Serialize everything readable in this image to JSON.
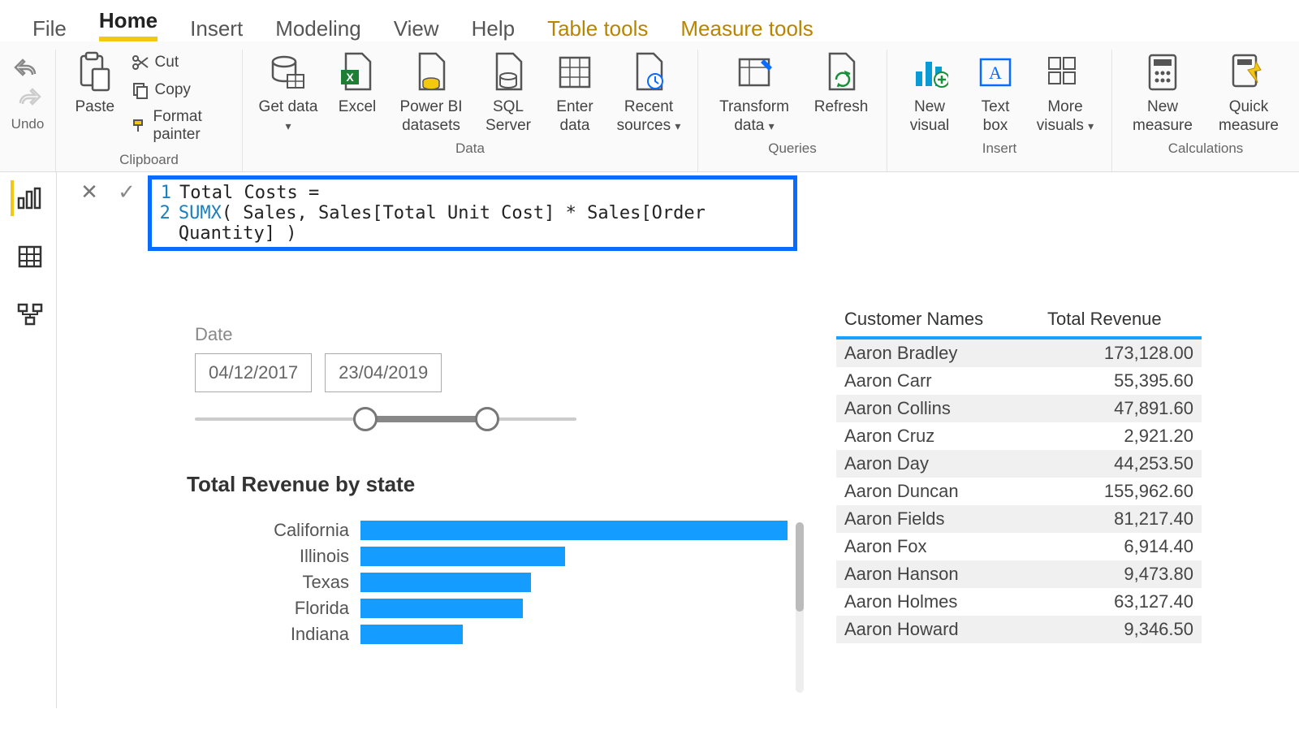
{
  "menu": {
    "file": "File",
    "home": "Home",
    "insert": "Insert",
    "modeling": "Modeling",
    "view": "View",
    "help": "Help",
    "table_tools": "Table tools",
    "measure_tools": "Measure tools"
  },
  "ribbon": {
    "undo_label": "Undo",
    "paste": "Paste",
    "cut": "Cut",
    "copy": "Copy",
    "format_painter": "Format painter",
    "clipboard": "Clipboard",
    "get_data": "Get data",
    "excel": "Excel",
    "pbi_datasets": "Power BI datasets",
    "sql_server": "SQL Server",
    "enter_data": "Enter data",
    "recent_sources": "Recent sources",
    "data": "Data",
    "transform_data": "Transform data",
    "refresh": "Refresh",
    "queries": "Queries",
    "new_visual": "New visual",
    "text_box": "Text box",
    "more_visuals": "More visuals",
    "insert": "Insert",
    "new_measure": "New measure",
    "quick_measure": "Quick measure",
    "calculations": "Calculations"
  },
  "formula": {
    "line1_num": "1",
    "line1": "Total Costs =",
    "line2_num": "2",
    "kw": "SUMX",
    "rest": "( Sales, Sales[Total Unit Cost] * Sales[Order Quantity] )"
  },
  "slicer": {
    "label": "Date",
    "from": "04/12/2017",
    "to": "23/04/2019"
  },
  "chart_data": {
    "type": "bar",
    "title": "Total Revenue by state",
    "xlabel": "",
    "ylabel": "",
    "categories": [
      "California",
      "Illinois",
      "Texas",
      "Florida",
      "Indiana"
    ],
    "values": [
      100,
      48,
      40,
      38,
      24
    ],
    "value_note": "values are relative bar lengths in percent of max; exact revenue amounts are not displayed on chart"
  },
  "table": {
    "col1": "Customer Names",
    "col2": "Total Revenue",
    "rows": [
      {
        "name": "Aaron Bradley",
        "rev": "173,128.00"
      },
      {
        "name": "Aaron Carr",
        "rev": "55,395.60"
      },
      {
        "name": "Aaron Collins",
        "rev": "47,891.60"
      },
      {
        "name": "Aaron Cruz",
        "rev": "2,921.20"
      },
      {
        "name": "Aaron Day",
        "rev": "44,253.50"
      },
      {
        "name": "Aaron Duncan",
        "rev": "155,962.60"
      },
      {
        "name": "Aaron Fields",
        "rev": "81,217.40"
      },
      {
        "name": "Aaron Fox",
        "rev": "6,914.40"
      },
      {
        "name": "Aaron Hanson",
        "rev": "9,473.80"
      },
      {
        "name": "Aaron Holmes",
        "rev": "63,127.40"
      },
      {
        "name": "Aaron Howard",
        "rev": "9,346.50"
      }
    ]
  }
}
